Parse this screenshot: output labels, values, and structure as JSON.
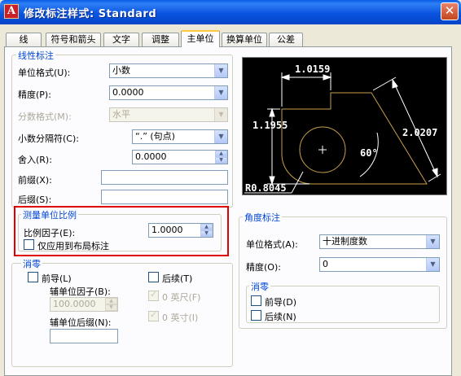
{
  "window": {
    "app_icon_glyph": "A",
    "title": "修改标注样式: Standard",
    "close_glyph": "✕"
  },
  "tabs": [
    "线",
    "符号和箭头",
    "文字",
    "调整",
    "主单位",
    "换算单位",
    "公差"
  ],
  "active_tab": "主单位",
  "linear": {
    "group_title": "线性标注",
    "unit_format_label": "单位格式(U):",
    "unit_format_value": "小数",
    "precision_label": "精度(P):",
    "precision_value": "0.0000",
    "fraction_format_label": "分数格式(M):",
    "fraction_format_value": "水平",
    "decimal_separator_label": "小数分隔符(C):",
    "decimal_separator_value": "“.” (句点)",
    "round_off_label": "舍入(R):",
    "round_off_value": "0.0000",
    "prefix_label": "前缀(X):",
    "prefix_value": "",
    "suffix_label": "后缀(S):",
    "suffix_value": ""
  },
  "scale": {
    "group_title": "测量单位比例",
    "factor_label": "比例因子(E):",
    "factor_value": "1.0000",
    "layout_only_label": "仅应用到布局标注",
    "layout_only_checked": false
  },
  "zero_suppression": {
    "group_title": "消零",
    "leading_label": "前导(L)",
    "leading_checked": false,
    "trailing_label": "后续(T)",
    "trailing_checked": false,
    "sub_unit_factor_label": "辅单位因子(B):",
    "sub_unit_factor_value": "100.0000",
    "sub_unit_suffix_label": "辅单位后缀(N):",
    "sub_unit_suffix_value": "",
    "zero_feet_label": "0 英尺(F)",
    "zero_feet_checked": true,
    "zero_inches_label": "0 英寸(I)",
    "zero_inches_checked": true
  },
  "preview": {
    "dim_top": "1.0159",
    "dim_left": "1.1955",
    "dim_right": "2.0207",
    "dim_angle": "60°",
    "dim_radius": "R0.8045",
    "line_color": "#c8a04a",
    "dim_color": "#ffffff"
  },
  "angular": {
    "group_title": "角度标注",
    "unit_format_label": "单位格式(A):",
    "unit_format_value": "十进制度数",
    "precision_label": "精度(O):",
    "precision_value": "0",
    "zero_group_title": "消零",
    "leading_label": "前导(D)",
    "leading_checked": false,
    "trailing_label": "后续(N)",
    "trailing_checked": false
  },
  "colors": {
    "title_bar": "#0a5ce8",
    "group_title": "#0046d5",
    "highlight_box": "#e00000"
  }
}
